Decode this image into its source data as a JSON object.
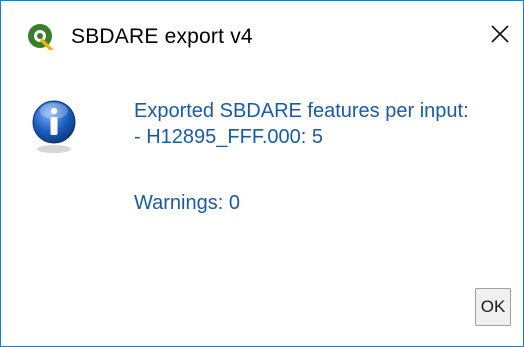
{
  "window": {
    "title": "SBDARE export v4",
    "app_icon": "qgis-icon",
    "close_icon": "close-icon"
  },
  "message": {
    "icon": "info-icon",
    "line1": "Exported SBDARE features per input:",
    "line2": "- H12895_FFF.000: 5",
    "warnings": "Warnings: 0"
  },
  "buttons": {
    "ok_label": "OK"
  },
  "colors": {
    "message_text": "#1b5aa6",
    "border": "#1a7fd1"
  }
}
